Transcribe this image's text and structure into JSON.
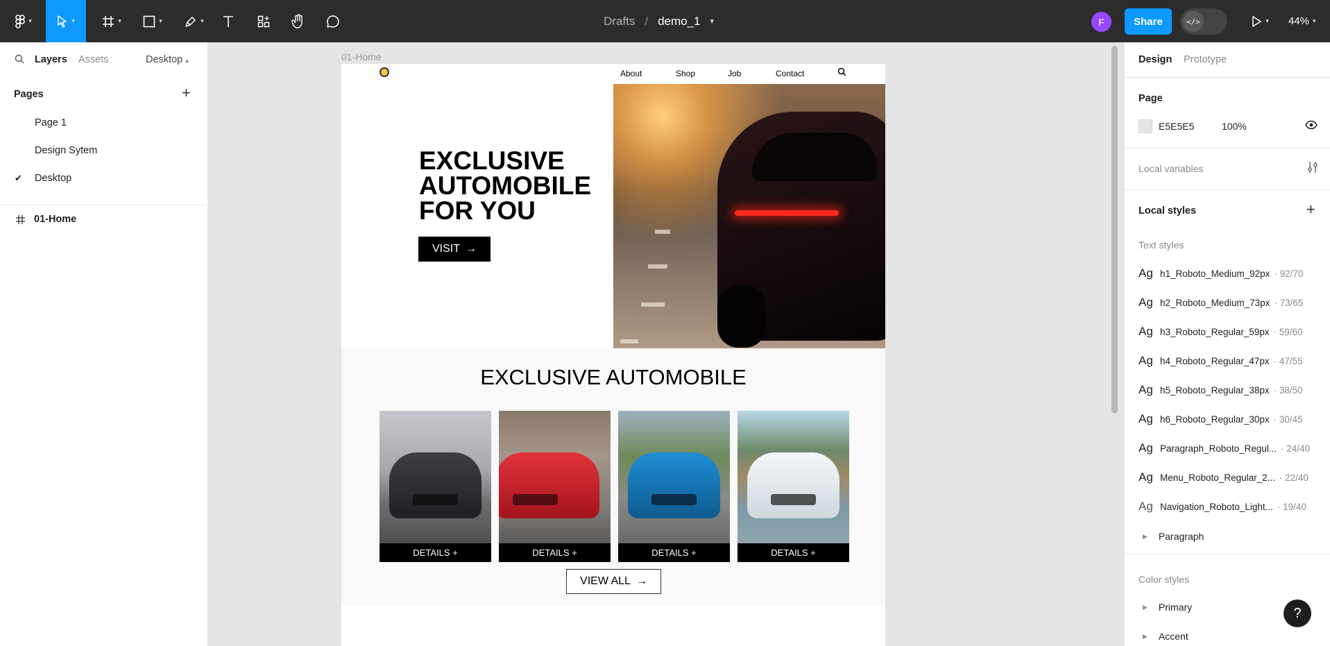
{
  "toolbar": {
    "breadcrumb_drafts": "Drafts",
    "breadcrumb_sep": "/",
    "file_name": "demo_1",
    "avatar_letter": "F",
    "share_label": "Share",
    "dev_mode_glyph": "</>",
    "zoom": "44%",
    "accent": "#0d99ff"
  },
  "left_panel": {
    "tabs": {
      "layers": "Layers",
      "assets": "Assets"
    },
    "page_dropdown": "Desktop",
    "pages_heading": "Pages",
    "pages": [
      "Page 1",
      "Design Sytem",
      "Desktop"
    ],
    "current_page": "Desktop",
    "layers": [
      {
        "name": "01-Home",
        "icon": "frame-icon"
      }
    ]
  },
  "canvas": {
    "frame_label": "01-Home",
    "nav_links": [
      "About",
      "Shop",
      "Job",
      "Contact"
    ],
    "hero_title": "EXCLUSIVE AUTOMOBILE FOR YOU",
    "visit_label": "VISIT",
    "section_title": "EXCLUSIVE AUTOMOBILE",
    "card_button": "DETAILS +",
    "view_all_label": "VIEW ALL"
  },
  "right_panel": {
    "tabs": {
      "design": "Design",
      "prototype": "Prototype"
    },
    "page_heading": "Page",
    "page_color_hex": "E5E5E5",
    "page_color_opacity": "100%",
    "local_variables": "Local variables",
    "local_styles": "Local styles",
    "text_styles_heading": "Text styles",
    "text_styles": [
      {
        "name": "h1_Roboto_Medium_92px",
        "size": "· 92/70"
      },
      {
        "name": "h2_Roboto_Medium_73px",
        "size": "· 73/65"
      },
      {
        "name": "h3_Roboto_Regular_59px",
        "size": "· 59/60"
      },
      {
        "name": "h4_Roboto_Regular_47px",
        "size": "· 47/55"
      },
      {
        "name": "h5_Roboto_Regular_38px",
        "size": "· 38/50"
      },
      {
        "name": "h6_Roboto_Regular_30px",
        "size": "· 30/45"
      },
      {
        "name": "Paragraph_Roboto_Regul...",
        "size": "· 24/40"
      },
      {
        "name": "Menu_Roboto_Regular_2...",
        "size": "· 22/40"
      },
      {
        "name": "Navigation_Roboto_Light...",
        "size": "· 19/40"
      }
    ],
    "ag_label": "Ag",
    "paragraph_group": "Paragraph",
    "color_styles_heading": "Color styles",
    "color_groups": [
      "Primary",
      "Accent"
    ]
  },
  "help_label": "?"
}
